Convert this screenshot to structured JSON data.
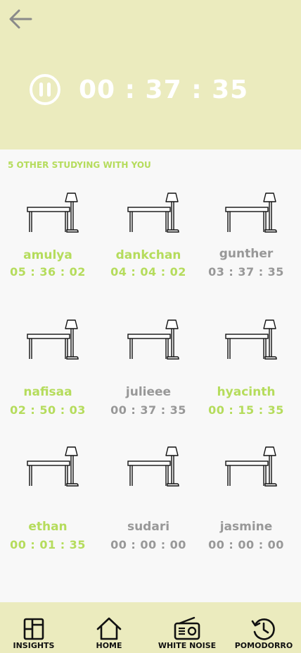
{
  "header": {
    "timer": "00 : 37 : 35",
    "back_icon": "arrow-left-icon",
    "pause_icon": "pause-circle-icon"
  },
  "studying": {
    "heading": "5 OTHER STUDYING WITH YOU",
    "users": [
      {
        "name": "amulya",
        "time": "05 : 36 : 02",
        "active": true
      },
      {
        "name": "dankchan",
        "time": "04 : 04 : 02",
        "active": true
      },
      {
        "name": "gunther",
        "time": "03 : 37 : 35",
        "active": false
      },
      {
        "name": "nafisaa",
        "time": "02 : 50 : 03",
        "active": true
      },
      {
        "name": "julieee",
        "time": "00 : 37 : 35",
        "active": false
      },
      {
        "name": "hyacinth",
        "time": "00 : 15 : 35",
        "active": true
      },
      {
        "name": "ethan",
        "time": "00 : 01 : 35",
        "active": true
      },
      {
        "name": "sudari",
        "time": "00 : 00 : 00",
        "active": false
      },
      {
        "name": "jasmine",
        "time": "00 : 00 : 00",
        "active": false
      }
    ],
    "desk_icon": "desk-lamp-icon"
  },
  "navbar": {
    "items": [
      {
        "label": "INSIGHTS",
        "icon": "insights-grid-icon"
      },
      {
        "label": "HOME",
        "icon": "home-icon"
      },
      {
        "label": "WHITE NOISE",
        "icon": "radio-icon"
      },
      {
        "label": "POMODORRO",
        "icon": "history-clock-icon"
      }
    ]
  },
  "colors": {
    "header_bg": "#ebebbe",
    "active_green": "#b5dc5c",
    "inactive_grey": "#989898",
    "page_bg": "#f8f8f8"
  }
}
